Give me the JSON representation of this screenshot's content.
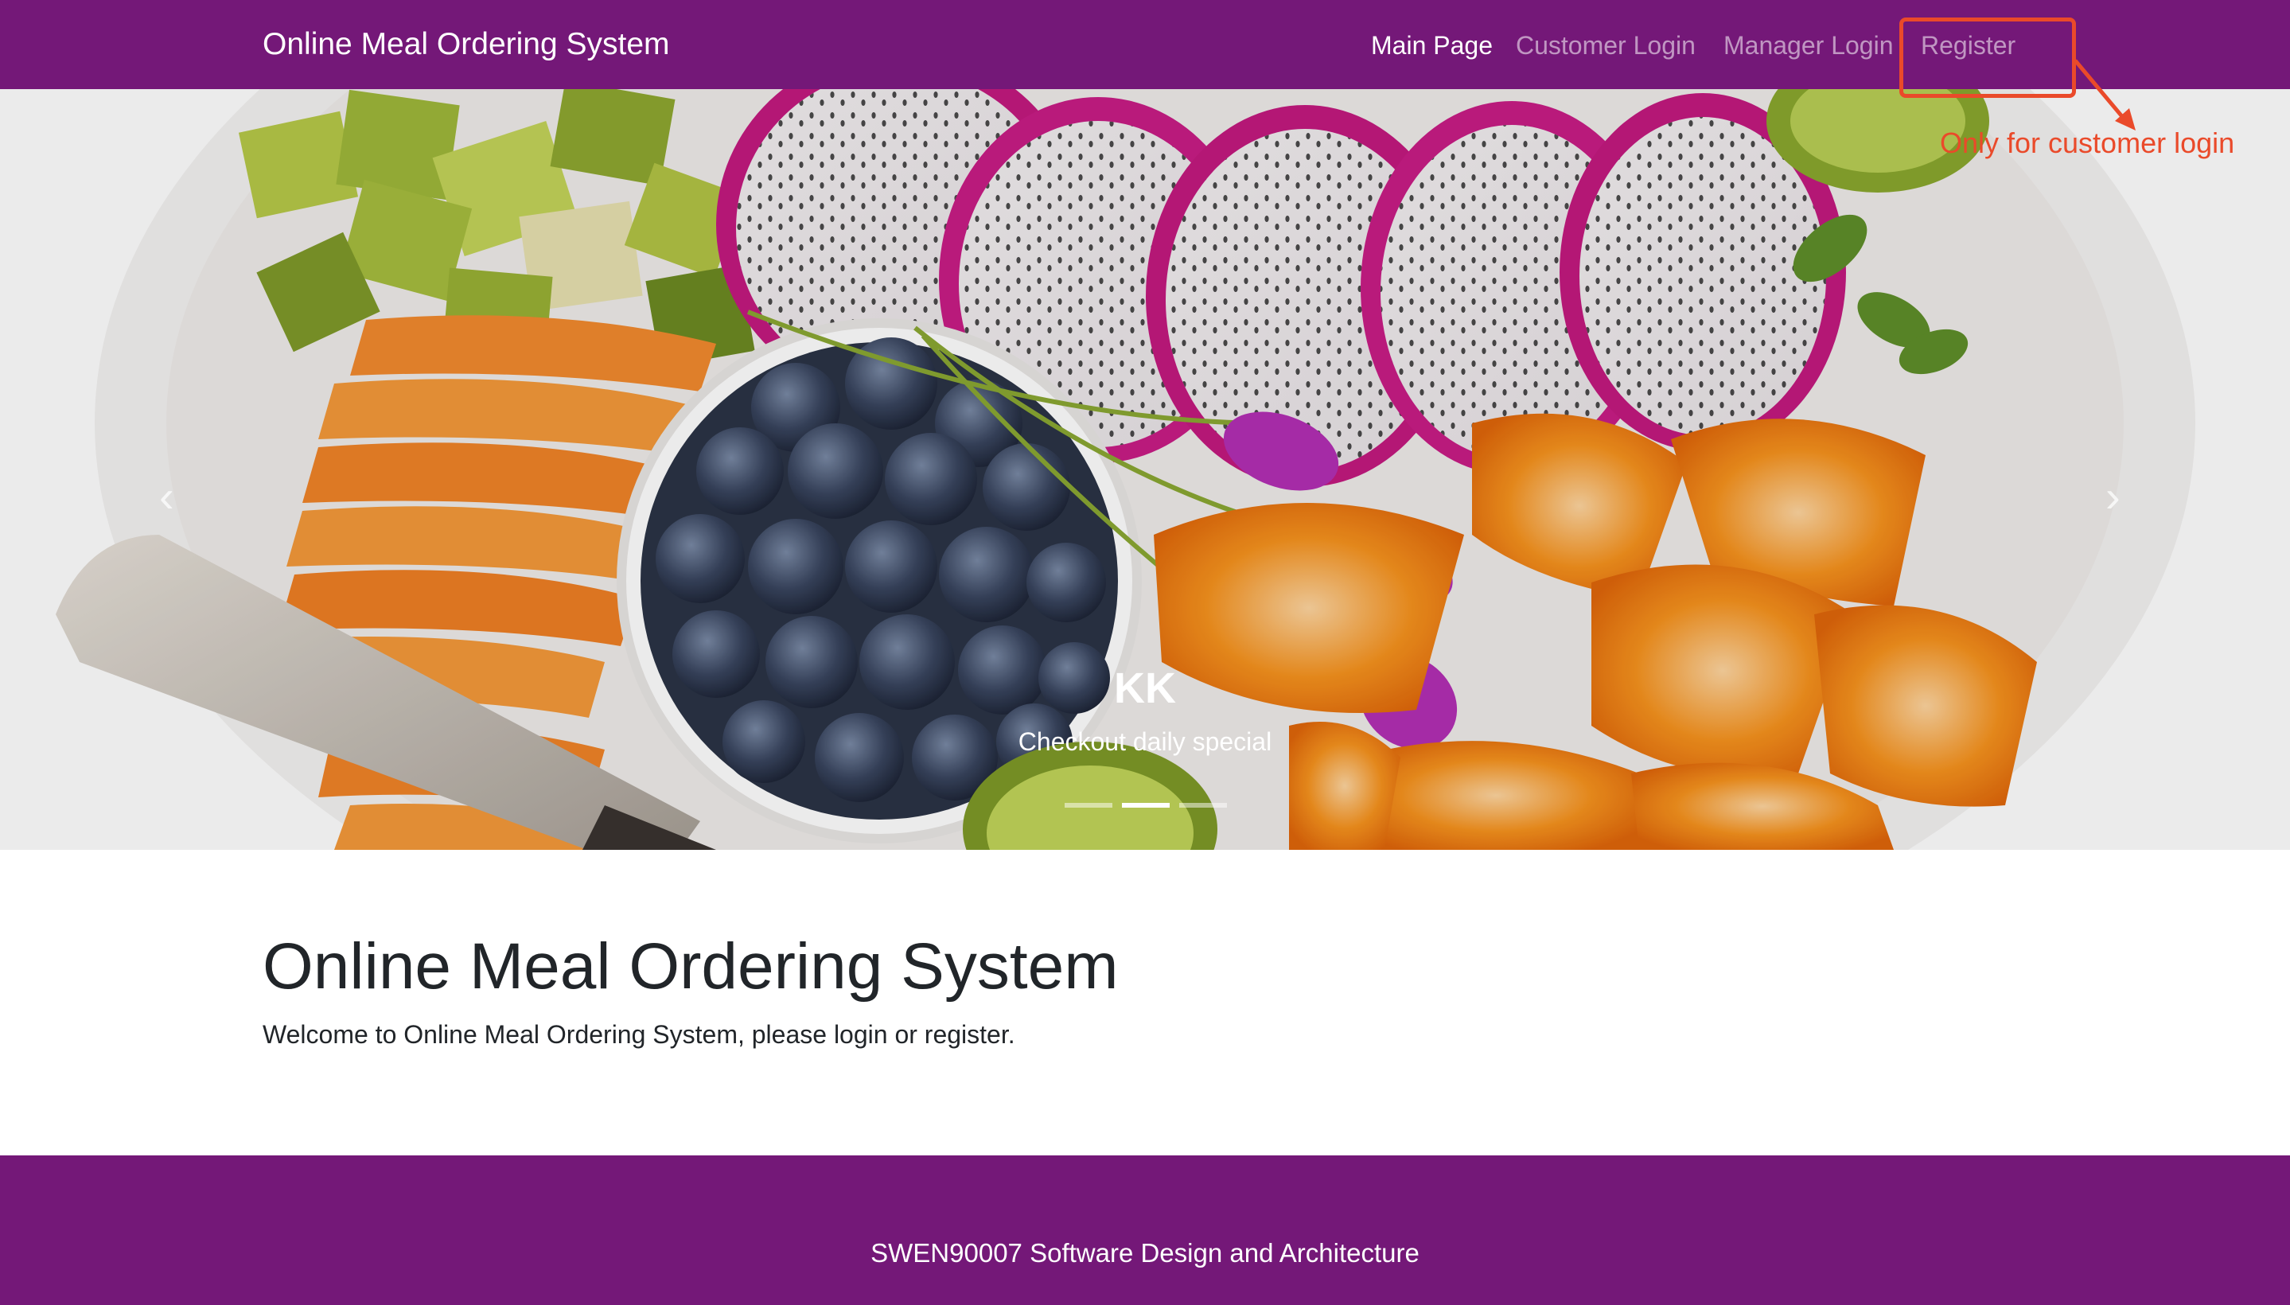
{
  "navbar": {
    "brand": "Online Meal Ordering System",
    "items": [
      {
        "label": "Main Page",
        "active": true
      },
      {
        "label": "Customer Login",
        "active": false
      },
      {
        "label": "Manager Login",
        "active": false
      },
      {
        "label": "Register",
        "active": false
      }
    ],
    "color": "#741878"
  },
  "annotation": {
    "text": "Only for customer login",
    "color": "#ea4a2a"
  },
  "carousel": {
    "caption_title": "KK",
    "caption_text": "Checkout daily special",
    "slide_count": 3,
    "active_slide": 2,
    "prev_icon": "chevron-left-icon",
    "next_icon": "chevron-right-icon"
  },
  "main": {
    "title": "Online Meal Ordering System",
    "lead": "Welcome to Online Meal Ordering System, please login or register."
  },
  "footer": {
    "text": "SWEN90007 Software Design and Architecture"
  }
}
